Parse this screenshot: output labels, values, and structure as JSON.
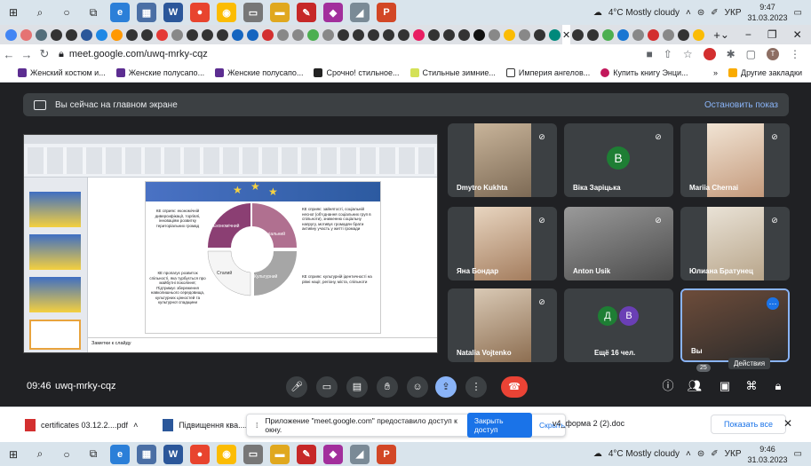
{
  "taskbar_top": {
    "weather": "4°C  Mostly cloudy",
    "lang": "УКР",
    "time": "9:47",
    "date": "31.03.2023"
  },
  "taskbar_bottom": {
    "weather": "4°C  Mostly cloudy",
    "lang": "УКР",
    "time": "9:46",
    "date": "31.03.2023"
  },
  "address": {
    "url": "meet.google.com/uwq-mrky-cqz"
  },
  "bookmarks": [
    {
      "label": "Женский костюм и..."
    },
    {
      "label": "Женские полусапо..."
    },
    {
      "label": "Женские полусапо..."
    },
    {
      "label": "Срочно! стильное..."
    },
    {
      "label": "Стильные зимние..."
    },
    {
      "label": "Империя ангелов..."
    },
    {
      "label": "Купить книгу Энци..."
    },
    {
      "label": "Другие закладки"
    }
  ],
  "presentation": {
    "status": "Вы сейчас на главном экране",
    "stop_label": "Остановить показ"
  },
  "slide": {
    "notes_label": "Заметки к слайду",
    "seg_economic": "Економічний",
    "seg_social": "Соціальний",
    "seg_cultural": "Культурний",
    "seg_stable": "Сталий",
    "txt_left_top": "КЕ сприяє: економічній диверсифікації, торгівлі, інноваціям розвитку територіальних громад",
    "txt_right_top": "КЕ сприяє: зайнятості, соціальній несної (об’єднання соціальних груп в спільноти), зниженню соціальну напругу, мотивує громадян брати активну участь у житті громади",
    "txt_left_bottom": "КЕ пропагує розвиток спільності, яка турбується про майбутні покоління; Підтримує збереження навколишнього середовища, культурних цінностей та культурної спадщини",
    "txt_right_bottom": "КЕ сприяє: культурній ідентичності на рівні нації, регіону, міста, спільноти"
  },
  "participants": [
    {
      "name": "Dmytro Kukhta"
    },
    {
      "name": "Віка Заріцька",
      "initial": "В"
    },
    {
      "name": "Mariia Chernai"
    },
    {
      "name": "Яна Бондар"
    },
    {
      "name": "Anton Usik"
    },
    {
      "name": "Юлиана Братунец"
    },
    {
      "name": "Natalia Vojtenko"
    },
    {
      "name": "Ещё 16 чел.",
      "initials": [
        "Д",
        "В"
      ]
    },
    {
      "name": "Вы"
    }
  ],
  "meeting": {
    "time": "09:46",
    "code": "uwq-mrky-cqz",
    "participant_count": "25",
    "actions_tooltip": "Действия"
  },
  "downloads": [
    {
      "label": "certificates 03.12.2....pdf"
    },
    {
      "label": "Підвищення ква....do"
    },
    {
      "label": "v4_форма 2 (2).doc"
    }
  ],
  "share_notice": {
    "text": "Приложение \"meet.google.com\" предоставило доступ к окну.",
    "close_access": "Закрыть доступ",
    "hide": "Скрыть"
  },
  "show_all": "Показать все"
}
